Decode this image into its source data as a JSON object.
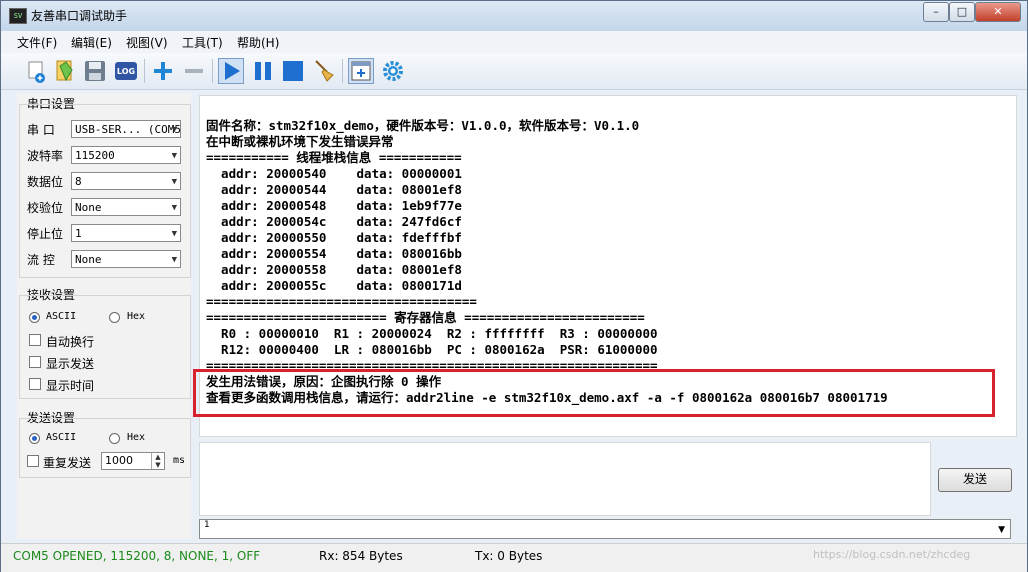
{
  "window": {
    "title": "友善串口调试助手",
    "icon_text": "SV"
  },
  "menu": [
    {
      "label": "文件(F)"
    },
    {
      "label": "编辑(E)"
    },
    {
      "label": "视图(V)"
    },
    {
      "label": "工具(T)"
    },
    {
      "label": "帮助(H)"
    }
  ],
  "toolbar": {
    "log_label": "LOG"
  },
  "serial_settings": {
    "title": "串口设置",
    "port_label": "串 口",
    "port_value": "USB-SER... (COM5",
    "baud_label": "波特率",
    "baud_value": "115200",
    "databits_label": "数据位",
    "databits_value": "8",
    "parity_label": "校验位",
    "parity_value": "None",
    "stopbits_label": "停止位",
    "stopbits_value": "1",
    "flow_label": "流 控",
    "flow_value": "None"
  },
  "receive_settings": {
    "title": "接收设置",
    "ascii_label": "ASCII",
    "hex_label": "Hex",
    "mode": "ASCII",
    "auto_wrap_label": "自动换行",
    "show_send_label": "显示发送",
    "show_time_label": "显示时间"
  },
  "send_settings": {
    "title": "发送设置",
    "ascii_label": "ASCII",
    "hex_label": "Hex",
    "mode": "ASCII",
    "repeat_label": "重复发送",
    "interval_value": "1000",
    "interval_unit": "ms"
  },
  "receive_text": "固件名称：stm32f10x_demo，硬件版本号：V1.0.0，软件版本号：V0.1.0\n在中断或裸机环境下发生错误异常\n=========== 线程堆栈信息 ===========\n  addr: 20000540    data: 00000001\n  addr: 20000544    data: 08001ef8\n  addr: 20000548    data: 1eb9f77e\n  addr: 2000054c    data: 247fd6cf\n  addr: 20000550    data: fdefffbf\n  addr: 20000554    data: 080016bb\n  addr: 20000558    data: 08001ef8\n  addr: 2000055c    data: 0800171d\n====================================\n======================== 寄存器信息 ========================\n  R0 : 00000010  R1 : 20000024  R2 : ffffffff  R3 : 00000000\n  R12: 00000400  LR : 080016bb  PC : 0800162a  PSR: 61000000\n============================================================\n发生用法错误，原因：企图执行除 0 操作\n查看更多函数调用栈信息，请运行：addr2line -e stm32f10x_demo.axf -a -f 0800162a 080016b7 08001719",
  "send_button_label": "发送",
  "history_value": "1",
  "status": {
    "port_status": "COM5 OPENED, 115200, 8, NONE, 1, OFF",
    "rx": "Rx: 854 Bytes",
    "tx": "Tx: 0 Bytes",
    "port_status_color": "#1a8a1a"
  },
  "watermark": "https://blog.csdn.net/zhcdeg"
}
